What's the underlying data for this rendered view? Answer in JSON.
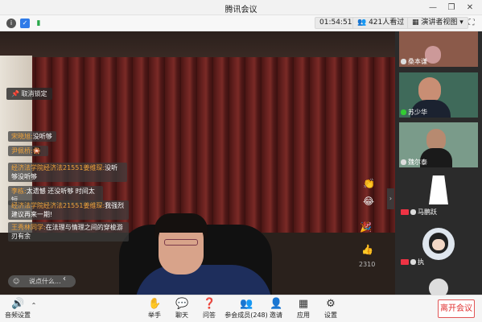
{
  "window": {
    "title": "腾讯会议",
    "min": "—",
    "restore": "❐",
    "close": "✕"
  },
  "infobar": {
    "timer": "01:54:51",
    "viewers": "421人看过",
    "view_mode": "演讲者视图",
    "fullscreen": "⛶"
  },
  "main": {
    "unpin_label": "取消锁定",
    "chat": [
      {
        "name": "宋晓旭:",
        "text": "没听够"
      },
      {
        "name": "尹佩桥:",
        "text": "🎇"
      },
      {
        "name": "经济法学院经济法21551姜维琛:",
        "text": "没听够没听够"
      },
      {
        "name": "李栋:",
        "text": "太遗憾  还没听够  时间太短"
      },
      {
        "name": "经济法学院经济法21551姜维琛:",
        "text": "我强烈建议再来一期!"
      },
      {
        "name": "王秀林同学:",
        "text": "在法理与情理之间的穿梭游刃有余"
      }
    ],
    "chat_placeholder": "说点什么...",
    "like_count": "2310"
  },
  "sidebar": {
    "tiles": [
      {
        "name": "桑本谦"
      },
      {
        "name": "苏少华"
      },
      {
        "name": "魏尔泰"
      },
      {
        "name": "马鹏跃"
      },
      {
        "name": "执"
      },
      {
        "name": ""
      }
    ]
  },
  "toolbar": {
    "audio": "音频设置",
    "raise_hand": "举手",
    "chat": "聊天",
    "qa": "问答",
    "members": "参会成员(248)",
    "invite": "邀请",
    "apps": "应用",
    "settings": "设置",
    "leave": "离开会议"
  }
}
